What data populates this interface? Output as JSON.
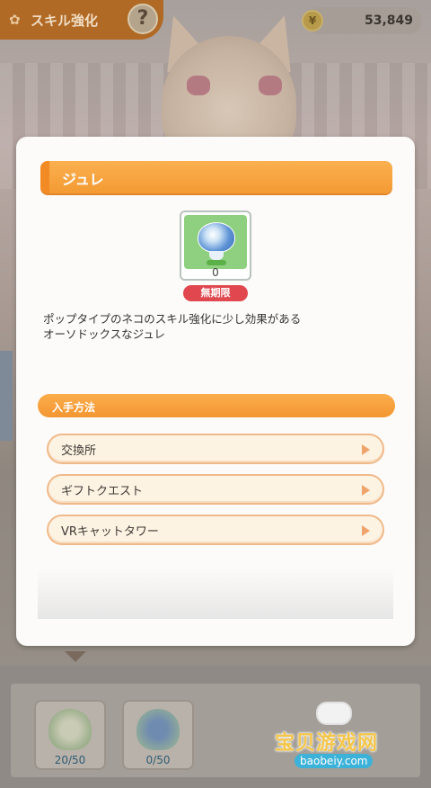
{
  "header": {
    "title": "スキル強化",
    "help_icon": "help-icon",
    "help_label": "?",
    "coin_icon": "coin-icon",
    "coin_value": "53,849"
  },
  "modal": {
    "title": "ジュレ",
    "item": {
      "icon": "jelly-icon",
      "quantity": "0",
      "badge": "無期限"
    },
    "description_line1": "ポップタイプのネコのスキル強化に少し効果がある",
    "description_line2": "オーソドックスなジュレ",
    "acquisition": {
      "title": "入手方法",
      "items": [
        {
          "label": "交換所"
        },
        {
          "label": "ギフトクエスト"
        },
        {
          "label": "VRキャットタワー"
        }
      ]
    }
  },
  "bottom_items": [
    {
      "count": "20/50"
    },
    {
      "count": "0/50"
    }
  ],
  "watermark": {
    "text": "宝贝游戏网",
    "url": "baobeiy.com"
  },
  "colors": {
    "accent_orange": "#f39a33",
    "badge_red": "#e0474e",
    "button_fill": "#fdf3e2",
    "button_border": "#f0b98a"
  }
}
